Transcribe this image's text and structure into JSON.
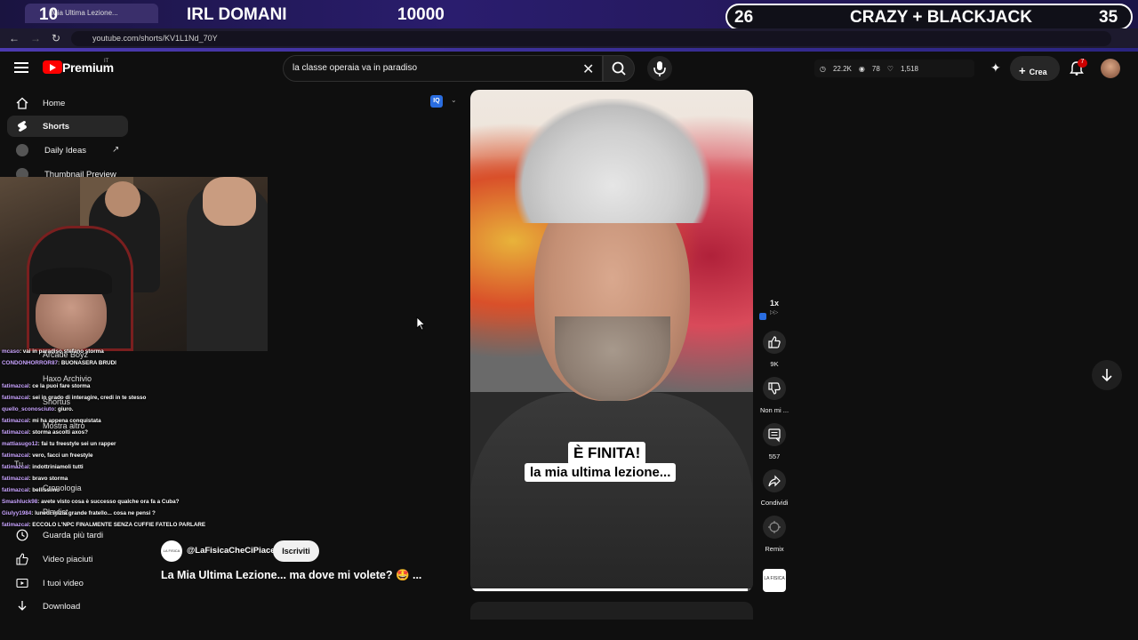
{
  "overlay": {
    "left_number": "10",
    "left_text": "IRL DOMANI",
    "center_number": "10000",
    "right_left_number": "26",
    "right_text": "CRAZY + BLACKJACK",
    "right_number": "35"
  },
  "browser": {
    "tab_title": "Mia Ultima Lezione...",
    "url": "youtube.com/shorts/KV1L1Nd_70Y"
  },
  "header": {
    "brand": "Premium",
    "region": "IT",
    "search_value": "la classe operaia va in paradiso",
    "stats": {
      "views": "22.2K",
      "watching": "78",
      "likes": "1,518"
    },
    "create_label": "Crea",
    "notifications_count": "7"
  },
  "sidebar": {
    "items": [
      {
        "label": "Home"
      },
      {
        "label": "Shorts"
      },
      {
        "label": "Daily Ideas"
      },
      {
        "label": "Thumbnail Preview"
      },
      {
        "label": "Arcade Boyz"
      },
      {
        "label": "Haxo Archivio"
      },
      {
        "label": "Shortus"
      },
      {
        "label": "Mostra altro"
      },
      {
        "label": "Tu"
      },
      {
        "label": "Cronologia"
      },
      {
        "label": "Playlist"
      },
      {
        "label": "Guarda più tardi"
      },
      {
        "label": "Video piaciuti"
      },
      {
        "label": "I tuoi video"
      },
      {
        "label": "Download"
      }
    ]
  },
  "chat": {
    "messages": [
      {
        "user": "mcaso",
        "text": ": vai in paradiso stefano storma"
      },
      {
        "user": "CONDONHORROR87",
        "text": ": BUONASERA BRUDI"
      },
      {
        "user": "fatimazcal",
        "text": ": ce la puoi fare storma"
      },
      {
        "user": "fatimazcal",
        "text": ": sei in grado di interagire, credi in te stesso"
      },
      {
        "user": "quello_sconosciuto",
        "text": ": giuro."
      },
      {
        "user": "fatimazcal",
        "text": ": mi ha appena conquistata"
      },
      {
        "user": "fatimazcal",
        "text": ": storma ascolti axos?"
      },
      {
        "user": "mattiasugo12",
        "text": ": fai tu freestyle sei un rapper"
      },
      {
        "user": "fatimazcal",
        "text": ": vero, facci un freestyle"
      },
      {
        "user": "fatimazcal",
        "text": ": indottriniamoli tutti"
      },
      {
        "user": "fatimazcal",
        "text": ": bravo storma"
      },
      {
        "user": "fatimazcal",
        "text": ": bellissimo"
      },
      {
        "user": "Smashluck98",
        "text": ": avete visto cosa è successo qualche ora fa a Cuba?"
      },
      {
        "user": "Giulyy1984",
        "text": ": lunedì inizia grande fratello... cosa ne pensi ?"
      },
      {
        "user": "fatimazcal",
        "text": ": ECCOLO L'NPC FINALMENTE SENZA CUFFIE FATELO PARLARE"
      }
    ]
  },
  "short": {
    "caption_line1": "È FINITA!",
    "caption_line2": "la mia ultima lezione...",
    "progress": 0.98,
    "channel": "@LaFisicaCheCiPiace",
    "subscribe_label": "Iscriviti",
    "title": "La Mia Ultima Lezione... ma dove mi volete? 🤩 ...",
    "speed": "1x"
  },
  "actions": {
    "likes": "9K",
    "dislike_label": "Non mi ...",
    "comments": "557",
    "share_label": "Condividi",
    "remix_label": "Remix"
  },
  "colors": {
    "accent": "#ff0000",
    "background": "#0f0f0f",
    "overlay": "#2a1d6e"
  }
}
